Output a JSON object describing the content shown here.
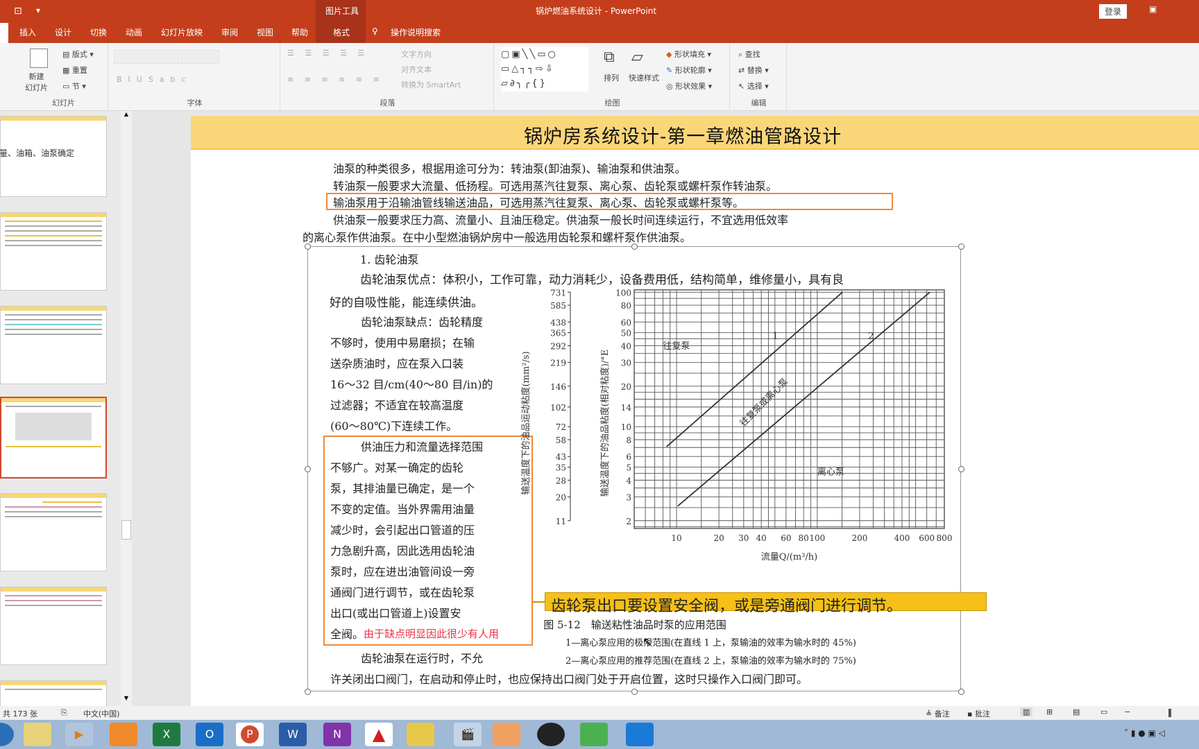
{
  "window": {
    "title": "锅炉燃油系统设计 - PowerPoint",
    "context_tab_group": "图片工具",
    "login": "登录"
  },
  "tabs": [
    "插入",
    "设计",
    "切换",
    "动画",
    "幻灯片放映",
    "审阅",
    "视图",
    "帮助",
    "格式"
  ],
  "selected_tab": "格式",
  "tell_me": "操作说明搜索",
  "ribbon": {
    "slides_group": {
      "label": "幻灯片",
      "new_slide": "新建\n幻灯片",
      "layout": "版式",
      "reset": "重置",
      "section": "节"
    },
    "font_group": {
      "label": "字体"
    },
    "paragraph_group": {
      "label": "段落",
      "text_direction": "文字方向",
      "align_text": "对齐文本",
      "smartart": "转换为 SmartArt"
    },
    "drawing_group": {
      "label": "绘图",
      "arrange": "排列",
      "quick_styles": "快速样式",
      "shape_fill": "形状填充",
      "shape_outline": "形状轮廓",
      "shape_effects": "形状效果"
    },
    "editing_group": {
      "label": "编辑",
      "find": "查找",
      "replace": "替换",
      "select": "选择"
    }
  },
  "thumbnails": {
    "first_text": "量、油箱、油泵确定",
    "selected_index": 3
  },
  "slide": {
    "title": "锅炉房系统设计-第一章燃油管路设计",
    "lines": [
      "油泵的种类很多，根据用途可分为：转油泵(卸油泵)、输油泵和供油泵。",
      "转油泵一般要求大流量、低扬程。可选用蒸汽往复泵、离心泵、齿轮泵或螺杆泵作转油泵。",
      "输油泵用于沿输油管线输送油品，可选用蒸汽往复泵、离心泵、齿轮泵或螺杆泵等。",
      "供油泵一般要求压力高、流量小、且油压稳定。供油泵一般长时间连续运行，不宜选用低效率",
      "的离心泵作供油泵。在中小型燃油锅炉房中一般选用齿轮泵和螺杆泵作供油泵。"
    ],
    "image": {
      "heading": "1. 齿轮油泵",
      "advantages": [
        "齿轮油泵优点：体积小，工作可靠，动力消耗少，设备费用低，结构简单，维修量小，具有良",
        "好的自吸性能，能连续供油。"
      ],
      "disadvantages": [
        "齿轮油泵缺点：齿轮精度",
        "不够时，使用中易磨损；在输",
        "送杂质油时，应在泵入口装",
        "16～32 目/cm(40～80 目/in)的",
        "过滤器；不适宜在较高温度",
        "(60～80℃)下连续工作。"
      ],
      "boxed": [
        "供油压力和流量选择范围",
        "不够广。对某一确定的齿轮",
        "泵，其排油量已确定，是一个",
        "不变的定值。当外界需用油量",
        "减少时，会引起出口管道的压",
        "力急剧升高，因此选用齿轮油",
        "泵时，应在进出油管间设一旁",
        "通阀门进行调节，或在齿轮泵",
        "出口(或出口管道上)设置安",
        "全阀。"
      ],
      "red_note": "由于缺点明显因此很少有人用",
      "closing": [
        "齿轮油泵在运行时，不允",
        "许关闭出口阀门，在启动和停止时，也应保持出口阀门处于开启位置，这时只操作入口阀门即可。"
      ],
      "figure_caption": "图 5-12　输送粘性油品时泵的应用范围",
      "legend": [
        "1—离心泵应用的极限范围(在直线 1 上，泵输油的效率为输水时的 45%)",
        "2—离心泵应用的推荐范围(在直线 2 上，泵输油的效率为输水时的 75%)"
      ]
    },
    "callout": "齿轮泵出口要设置安全阀，或是旁通阀门进行调节。"
  },
  "chart_data": {
    "type": "line",
    "xlabel": "流量Q/(m³/h)",
    "ylabel": "输送温度下的油品粘度(相对粘度)/°E",
    "ylabel_secondary": "输送温度下的油品运动粘度(mm²/s)",
    "x_scale": "log",
    "y_scale": "log",
    "xlim": [
      5,
      800
    ],
    "ylim": [
      1.75,
      104
    ],
    "grid": true,
    "x_ticks": [
      10,
      20,
      30,
      40,
      60,
      80,
      100,
      200,
      400,
      600,
      800
    ],
    "x_tick_labels": [
      "10",
      "20",
      "30",
      "40",
      "60",
      "80",
      "100",
      "200",
      "400",
      "600",
      "800"
    ],
    "y_ticks": [
      2,
      3,
      4,
      5,
      6,
      8,
      10,
      14,
      20,
      30,
      40,
      50,
      60,
      80,
      100
    ],
    "y_tick_labels": [
      "2",
      "3",
      "4",
      "5",
      "6",
      "8",
      "10",
      "14",
      "20",
      "30",
      "40",
      "50",
      "60",
      "80",
      "100"
    ],
    "y2_tick_labels": [
      "11",
      "20",
      "28",
      "35",
      "43",
      "58",
      "72",
      "102",
      "146",
      "219",
      "292",
      "365",
      "438",
      "585",
      "731"
    ],
    "series": [
      {
        "name": "1",
        "x": [
          8.5,
          151
        ],
        "y": [
          7.1,
          100
        ]
      },
      {
        "name": "2",
        "x": [
          10.2,
          631
        ],
        "y": [
          2.57,
          100
        ]
      }
    ],
    "region_labels": [
      "往复泵",
      "往复泵或离心泵",
      "离心泵"
    ],
    "line_color": "#333333"
  },
  "status": {
    "slide_count": "共 173 张",
    "language": "中文(中国)",
    "notes": "备注",
    "comments": "批注"
  },
  "colors": {
    "accent": "#c43e1c",
    "header": "#fbd679",
    "highlight_box": "#ec8a3c",
    "callout": "#f5c018",
    "red_note": "#e8344a"
  }
}
